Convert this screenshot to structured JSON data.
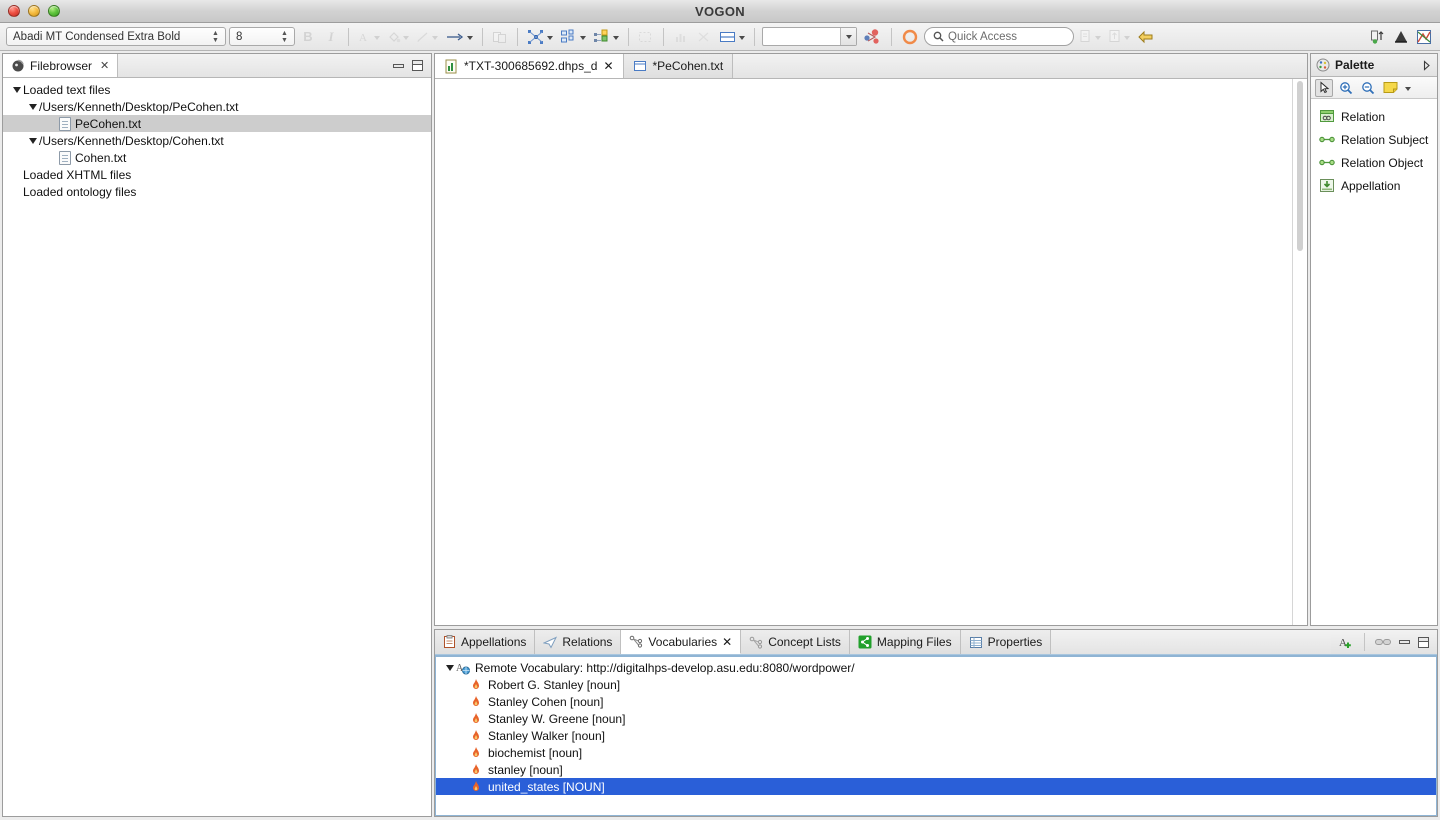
{
  "window": {
    "title": "VOGON",
    "controls": [
      "close",
      "minimize",
      "zoom"
    ]
  },
  "toolbar": {
    "font_family": "Abadi MT Condensed Extra Bold",
    "font_size": "8",
    "bold_label": "B",
    "italic_label": "I",
    "quick_access_placeholder": "Quick Access",
    "style_combo_value": ""
  },
  "filebrowser": {
    "tab_label": "Filebrowser",
    "tree": [
      {
        "label": "Loaded text files",
        "indent": 0,
        "twisty": true,
        "icon": null,
        "selected": false
      },
      {
        "label": "/Users/Kenneth/Desktop/PeCohen.txt",
        "indent": 1,
        "twisty": true,
        "icon": null,
        "selected": false
      },
      {
        "label": "PeCohen.txt",
        "indent": 2,
        "twisty": false,
        "icon": "file-icon",
        "selected": true
      },
      {
        "label": "/Users/Kenneth/Desktop/Cohen.txt",
        "indent": 1,
        "twisty": true,
        "icon": null,
        "selected": false
      },
      {
        "label": "Cohen.txt",
        "indent": 2,
        "twisty": false,
        "icon": "file-icon",
        "selected": false
      },
      {
        "label": "Loaded XHTML files",
        "indent": 0,
        "twisty": false,
        "icon": null,
        "selected": false
      },
      {
        "label": "Loaded ontology files",
        "indent": 0,
        "twisty": false,
        "icon": null,
        "selected": false
      }
    ]
  },
  "editor": {
    "tabs": [
      {
        "label": "*TXT-300685692.dhps_d",
        "active": true,
        "closable": true,
        "icon": "graph-file-icon"
      },
      {
        "label": "*PeCohen.txt",
        "active": false,
        "closable": false,
        "icon": "text-file-icon"
      }
    ]
  },
  "palette": {
    "title": "Palette",
    "tools": [
      "select-arrow-icon",
      "zoom-in-icon",
      "zoom-out-icon",
      "marquee-note-icon"
    ],
    "items": [
      {
        "label": "Relation",
        "icon": "relation-icon"
      },
      {
        "label": "Relation Subject",
        "icon": "relation-subject-icon"
      },
      {
        "label": "Relation Object",
        "icon": "relation-object-icon"
      },
      {
        "label": "Appellation",
        "icon": "appellation-icon"
      }
    ]
  },
  "bottom_panel": {
    "tabs": [
      {
        "label": "Appellations",
        "active": false,
        "icon": "clipboard-icon",
        "closable": false
      },
      {
        "label": "Relations",
        "active": false,
        "icon": "paperplane-icon",
        "closable": false
      },
      {
        "label": "Vocabularies",
        "active": true,
        "icon": "tree-node-icon",
        "closable": true
      },
      {
        "label": "Concept Lists",
        "active": false,
        "icon": "tree-node-icon",
        "closable": false
      },
      {
        "label": "Mapping Files",
        "active": false,
        "icon": "share-green-icon",
        "closable": false
      },
      {
        "label": "Properties",
        "active": false,
        "icon": "table-icon",
        "closable": false
      }
    ],
    "vocabulary": {
      "root_label": "Remote Vocabulary: http://digitalhps-develop.asu.edu:8080/wordpower/",
      "entries": [
        {
          "label": "Robert G. Stanley [noun]",
          "selected": false
        },
        {
          "label": "Stanley Cohen [noun]",
          "selected": false
        },
        {
          "label": "Stanley W. Greene [noun]",
          "selected": false
        },
        {
          "label": "Stanley Walker [noun]",
          "selected": false
        },
        {
          "label": "biochemist [noun]",
          "selected": false
        },
        {
          "label": "stanley [noun]",
          "selected": false
        },
        {
          "label": "united_states [NOUN]",
          "selected": true
        }
      ]
    }
  },
  "colors": {
    "selection_blue": "#2a5fd8",
    "tree_selection_gray": "#cdcdcd",
    "panel_border": "#9c9c9c",
    "accent_green": "#22aa33",
    "flame_orange": "#e8632a"
  }
}
